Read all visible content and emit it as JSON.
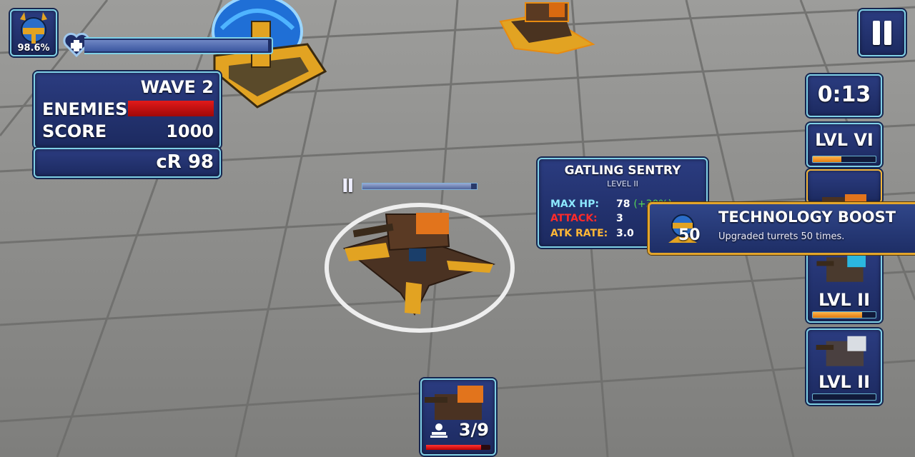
{
  "player": {
    "shield_percent": "98.6%",
    "health_fraction": 0.98
  },
  "wave": {
    "title": "WAVE 2",
    "enemies_label": "ENEMIES",
    "enemies_fraction": 1.0,
    "score_label": "SCORE",
    "score_value": "1000",
    "credits": "cR 98"
  },
  "timer": "0:13",
  "turret_cards": [
    {
      "level": "LVL VI",
      "xp_fraction": 0.45
    },
    {
      "level": "",
      "xp_fraction": 0
    },
    {
      "level": "LVL II",
      "xp_fraction": 0.78
    },
    {
      "level": "LVL II",
      "xp_fraction": 0.0
    }
  ],
  "selected_turret": {
    "name": "GATLING SENTRY",
    "level": "LEVEL II",
    "rank_marker": "II",
    "health_fraction": 0.95,
    "stats": [
      {
        "label": "MAX HP:",
        "value": "78",
        "bonus": "(+30%)"
      },
      {
        "label": "ATTACK:",
        "value": "3"
      },
      {
        "label": "ATK RATE:",
        "value": "3.0"
      }
    ]
  },
  "toast": {
    "title": "TECHNOLOGY BOOST",
    "count": "50",
    "description": "Upgraded turrets 50 times."
  },
  "build_card": {
    "count": "3/9",
    "bar_fraction": 0.85
  },
  "colors": {
    "panel": "#24357a",
    "panel_border": "#7fd0e6",
    "enemy_bar": "#d01010",
    "gold": "#e3a52c",
    "hp_text": "#8ce8ff",
    "attack_text": "#ff2a2a",
    "rate_text": "#ffb736"
  },
  "icons": [
    "helmet-avatar-icon",
    "health-heart-icon",
    "pause-icon",
    "turret-icon",
    "orb-badge-icon",
    "worker-icon"
  ]
}
